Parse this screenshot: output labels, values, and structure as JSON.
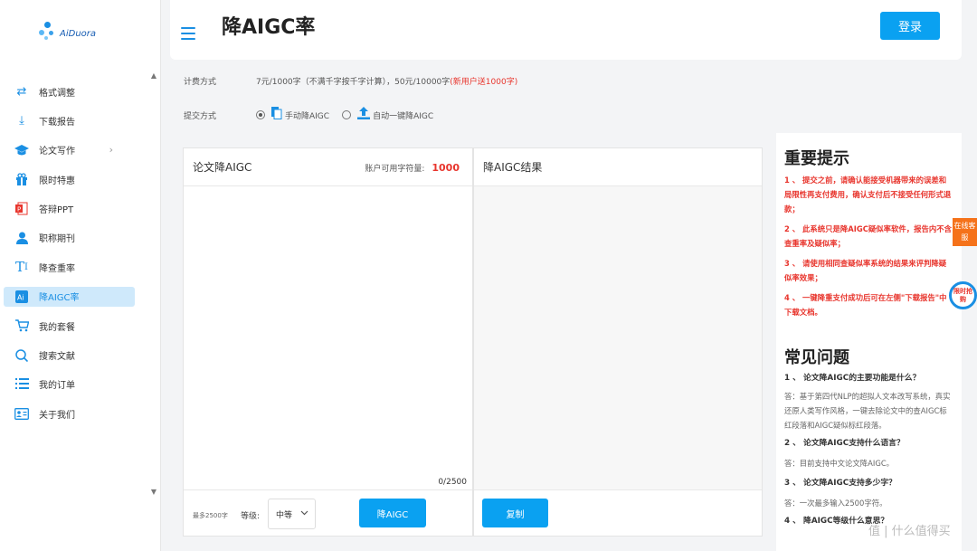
{
  "app": {
    "logo_text": "AiDuora",
    "login_label": "登录",
    "page_title": "降AIGC率"
  },
  "sidebar": {
    "items": [
      {
        "label": "格式调整",
        "icon": "swap-arrows-icon"
      },
      {
        "label": "下载报告",
        "icon": "download-icon"
      },
      {
        "label": "论文写作",
        "icon": "graduation-cap-icon",
        "chevron": "›"
      },
      {
        "label": "限时特惠",
        "icon": "gift-icon"
      },
      {
        "label": "答辩PPT",
        "icon": "ppt-icon"
      },
      {
        "label": "职称期刊",
        "icon": "person-icon"
      },
      {
        "label": "降查重率",
        "icon": "text-t-icon"
      },
      {
        "label": "降AIGC率",
        "icon": "ai-badge-icon",
        "active": true
      },
      {
        "label": "我的套餐",
        "icon": "cart-icon"
      },
      {
        "label": "搜索文献",
        "icon": "search-icon"
      },
      {
        "label": "我的订单",
        "icon": "list-icon"
      },
      {
        "label": "关于我们",
        "icon": "contact-card-icon"
      }
    ]
  },
  "pricing": {
    "label": "计费方式",
    "text": "7元/1000字（不满千字按千字计算），50元/10000字",
    "highlight": "(新用户送1000字)"
  },
  "submit": {
    "label": "提交方式",
    "option_manual": "手动降AIGC",
    "option_auto": "自动一键降AIGC"
  },
  "left_panel": {
    "title": "论文降AIGC",
    "credits_label": "账户可用字符量:",
    "credits_value": "1000",
    "counter": "0/2500",
    "max_note": "最多2500字",
    "level_label": "等级:",
    "level_value": "中等",
    "reduce_label": "降AIGC"
  },
  "right_panel": {
    "title": "降AIGC结果",
    "copy_label": "复制"
  },
  "tips": {
    "title": "重要提示",
    "items": [
      "1 、  提交之前，请确认能接受机器带来的误差和局限性再支付费用，确认支付后不接受任何形式退款；",
      "2 、  此系统只是降AIGC疑似率软件，报告内不含查重率及疑似率；",
      "3 、  请使用相同查疑似率系统的结果来评判降疑似率效果；",
      "4 、  一键降重支付成功后可在左侧\"下载报告\"中下载文档。"
    ],
    "faq_title": "常见问题",
    "faq": [
      {
        "q": "1 、  论文降AIGC的主要功能是什么？",
        "a": "答：基于第四代NLP的超拟人文本改写系统，真实还原人类写作风格，一键去除论文中的查AIGC标红段落和AIGC疑似标红段落。"
      },
      {
        "q": "2 、  论文降AIGC支持什么语言？",
        "a": "答：目前支持中文论文降AIGC。"
      },
      {
        "q": "3 、  论文降AIGC支持多少字？",
        "a": "答：一次最多输入2500字符。"
      },
      {
        "q": "4 、  降AIGC等级什么意思？",
        "a": ""
      }
    ]
  },
  "floating": {
    "service": "在线客服",
    "deal": "限时抢购"
  },
  "watermark": "值 | 什么值得买"
}
